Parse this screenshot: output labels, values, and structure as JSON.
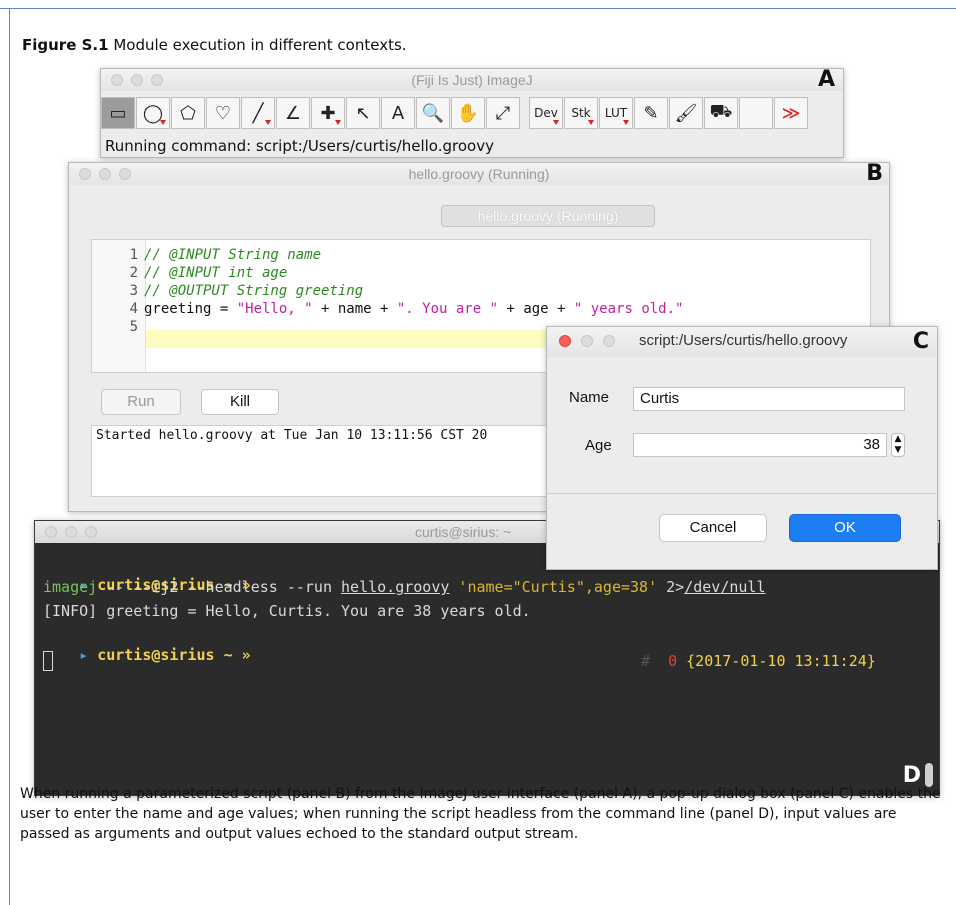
{
  "figure": {
    "label": "Figure S.1",
    "title": "Module execution in different contexts.",
    "footnote": "When running a parameterized script (panel B) from the ImageJ user interface (panel A), a pop-up dialog box (panel C) enables the user to enter the name and age values; when running the script headless from the command line (panel D), input values are passed as arguments and output values echoed to the standard output stream."
  },
  "panel_a": {
    "letter": "A",
    "window_title": "(Fiji Is Just) ImageJ",
    "tools": [
      {
        "name": "rectangle-tool",
        "glyph": "▭"
      },
      {
        "name": "oval-tool",
        "glyph": "◯"
      },
      {
        "name": "polygon-tool",
        "glyph": "⬠"
      },
      {
        "name": "freehand-tool",
        "glyph": "♡"
      },
      {
        "name": "line-tool",
        "glyph": "╱"
      },
      {
        "name": "angle-tool",
        "glyph": "∠"
      },
      {
        "name": "point-tool",
        "glyph": "✚"
      },
      {
        "name": "wand-tool",
        "glyph": "↖"
      },
      {
        "name": "text-tool",
        "glyph": "A"
      },
      {
        "name": "zoom-tool",
        "glyph": "🔍"
      },
      {
        "name": "hand-tool",
        "glyph": "✋"
      },
      {
        "name": "color-picker-tool",
        "glyph": "⤢"
      },
      {
        "name": "dev-menu",
        "glyph": "Dev"
      },
      {
        "name": "stk-menu",
        "glyph": "Stk"
      },
      {
        "name": "lut-menu",
        "glyph": "LUT"
      },
      {
        "name": "pencil-tool",
        "glyph": "✎"
      },
      {
        "name": "brush-tool",
        "glyph": "🖌"
      },
      {
        "name": "flood-fill-tool",
        "glyph": "⛟"
      },
      {
        "name": "empty-slot",
        "glyph": ""
      },
      {
        "name": "more-tools",
        "glyph": "≫"
      }
    ],
    "status": "Running command: script:/Users/curtis/hello.groovy"
  },
  "panel_b": {
    "letter": "B",
    "window_title": "hello.groovy (Running)",
    "tab_label": "hello.groovy (Running)",
    "code_lines": [
      {
        "num": "1",
        "text": "// @INPUT String name"
      },
      {
        "num": "2",
        "text": "// @INPUT int age"
      },
      {
        "num": "3",
        "text": "// @OUTPUT String greeting"
      },
      {
        "num": "4",
        "text": "greeting = \"Hello, \" + name + \". You are \" + age + \" years old.\""
      },
      {
        "num": "5",
        "text": ""
      }
    ],
    "run_label": "Run",
    "kill_label": "Kill",
    "console_text": "Started hello.groovy at Tue Jan 10 13:11:56 CST 20"
  },
  "panel_c": {
    "letter": "C",
    "window_title": "script:/Users/curtis/hello.groovy",
    "name_label": "Name",
    "name_value": "Curtis",
    "age_label": "Age",
    "age_value": "38",
    "cancel_label": "Cancel",
    "ok_label": "OK",
    "ok_color": "#1d7df2"
  },
  "panel_d": {
    "letter": "D",
    "window_title": "curtis@sirius: ~",
    "prompt_user": "curtis@sirius ~ »",
    "command_prog": "imagej",
    "command_args": " -- --ij2 --headless --run ",
    "command_file": "hello.groovy",
    "command_str": " 'name=\"Curtis\",age=38'",
    "command_redirect": " 2>",
    "command_devnull": "/dev/null",
    "output_line": "[INFO] greeting = Hello, Curtis. You are 38 years old.",
    "rprompt_hash": "#",
    "rprompt_code": "0",
    "rprompt_time": "{2017-01-10 13:11:24}"
  }
}
